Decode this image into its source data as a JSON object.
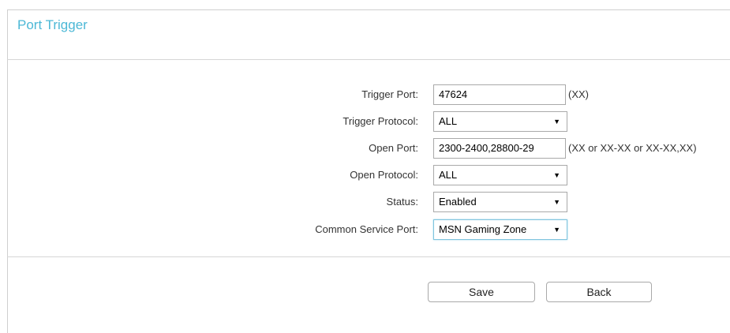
{
  "panel": {
    "title": "Port Trigger"
  },
  "form": {
    "trigger_port": {
      "label": "Trigger Port:",
      "value": "47624",
      "hint": "(XX)"
    },
    "trigger_protocol": {
      "label": "Trigger Protocol:",
      "value": "ALL"
    },
    "open_port": {
      "label": "Open Port:",
      "value": "2300-2400,28800-29",
      "hint": "(XX or XX-XX or XX-XX,XX)"
    },
    "open_protocol": {
      "label": "Open Protocol:",
      "value": "ALL"
    },
    "status": {
      "label": "Status:",
      "value": "Enabled"
    },
    "common_service_port": {
      "label": "Common Service Port:",
      "value": "MSN Gaming Zone"
    },
    "dropdown_arrow": "▼"
  },
  "buttons": {
    "save": "Save",
    "back": "Back"
  },
  "colors": {
    "title": "#4cb8d6",
    "border": "#a9a9a9",
    "focus": "#7fc4de"
  }
}
